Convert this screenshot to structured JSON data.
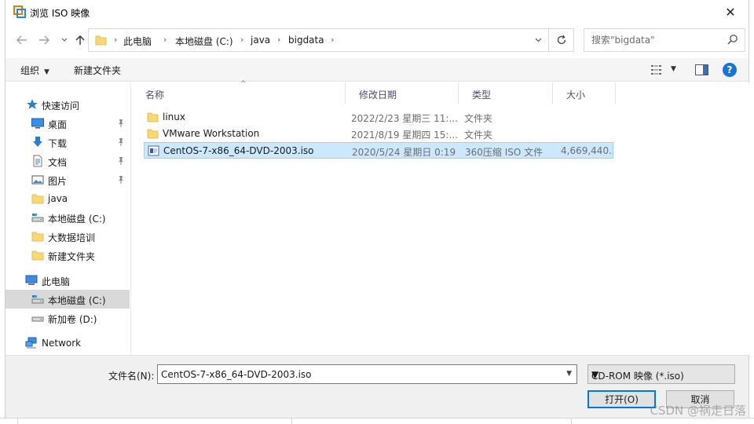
{
  "window": {
    "title": "浏览 ISO 映像",
    "close_symbol": "✕"
  },
  "address": {
    "crumbs": [
      "此电脑",
      "本地磁盘 (C:)",
      "java",
      "bigdata"
    ]
  },
  "search": {
    "placeholder": "搜索\"bigdata\""
  },
  "toolbar": {
    "organize_label": "组织",
    "new_folder_label": "新建文件夹",
    "help_label": "?"
  },
  "sidebar": {
    "items": [
      {
        "label": "快速访问",
        "icon": "star-icon",
        "pinned": false
      },
      {
        "label": "桌面",
        "icon": "desktop-icon",
        "pinned": true
      },
      {
        "label": "下载",
        "icon": "download-icon",
        "pinned": true
      },
      {
        "label": "文档",
        "icon": "document-icon",
        "pinned": true
      },
      {
        "label": "图片",
        "icon": "pictures-icon",
        "pinned": true
      },
      {
        "label": "java",
        "icon": "folder-icon",
        "pinned": false
      },
      {
        "label": "本地磁盘 (C:)",
        "icon": "drive-icon",
        "pinned": false
      },
      {
        "label": "大数据培训",
        "icon": "folder-icon",
        "pinned": false
      },
      {
        "label": "新建文件夹",
        "icon": "folder-icon",
        "pinned": false
      },
      {
        "label": "此电脑",
        "icon": "computer-icon",
        "pinned": false
      },
      {
        "label": "本地磁盘 (C:)",
        "icon": "drive-icon",
        "pinned": false,
        "selected": true
      },
      {
        "label": "新加卷 (D:)",
        "icon": "drive-icon",
        "pinned": false
      },
      {
        "label": "Network",
        "icon": "network-icon",
        "pinned": false
      }
    ]
  },
  "filelist": {
    "columns": [
      "名称",
      "修改日期",
      "类型",
      "大小"
    ],
    "rows": [
      {
        "name": "linux",
        "date": "2022/2/23 星期三 11:...",
        "type": "文件夹",
        "size": "",
        "icon": "folder-icon"
      },
      {
        "name": "VMware Workstation",
        "date": "2021/8/19 星期四 15:...",
        "type": "文件夹",
        "size": "",
        "icon": "folder-icon"
      },
      {
        "name": "CentOS-7-x86_64-DVD-2003.iso",
        "date": "2020/5/24 星期日 0:19",
        "type": "360压缩 ISO 文件",
        "size": "4,669,440...",
        "icon": "iso-file-icon",
        "selected": true
      }
    ]
  },
  "bottom": {
    "filename_label": "文件名(N):",
    "filename_value": "CentOS-7-x86_64-DVD-2003.iso",
    "filetype_value": "CD-ROM 映像 (*.iso)",
    "open_label": "打开(O)",
    "cancel_label": "取消"
  },
  "watermark": "CSDN @祸走日落",
  "colors": {
    "selection_bg": "#cce8ff",
    "selection_border": "#99d1ff",
    "accent": "#0078d7",
    "folder": "#f8d775"
  }
}
